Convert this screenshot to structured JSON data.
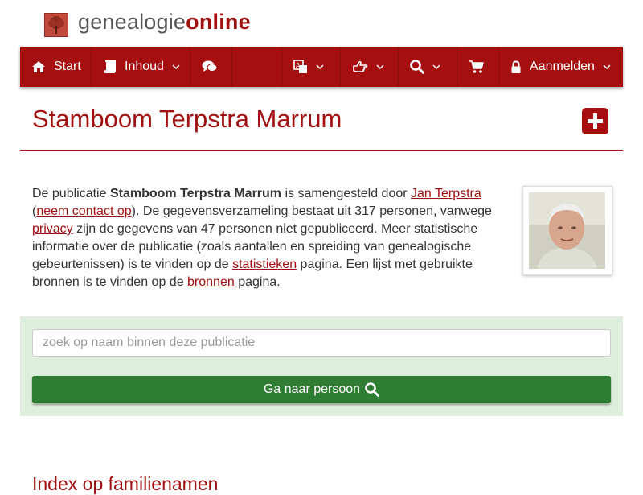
{
  "brand": {
    "part1": "genealogie",
    "part2": "online"
  },
  "nav": {
    "start": "Start",
    "inhoud": "Inhoud",
    "aanmelden": "Aanmelden"
  },
  "page": {
    "title": "Stamboom Terpstra Marrum"
  },
  "intro": {
    "t1": "De publicatie ",
    "pub_name": "Stamboom Terpstra Marrum",
    "t2": " is samengesteld door ",
    "author_link": "Jan Terpstra",
    "t3": " (",
    "contact_link": "neem contact op",
    "t4": "). De gegevensverzameling bestaat uit 317 personen, vanwege ",
    "privacy_link": "privacy",
    "t5": " zijn de gegevens van 47 personen niet gepubliceerd. Meer statistische informatie over de publicatie (zoals aantallen en spreiding van genealogische gebeurtenissen) is te vinden op de ",
    "stats_link": "statistieken",
    "t6": " pagina. Een lijst met gebruikte bronnen is te vinden op de ",
    "sources_link": "bronnen",
    "t7": " pagina."
  },
  "search": {
    "placeholder": "zoek op naam binnen deze publicatie",
    "button_label": "Ga naar persoon"
  },
  "section": {
    "heading": "Index op familienamen"
  },
  "colors": {
    "brand_red": "#a60f0f",
    "green_button": "#2e7d32",
    "search_bg": "#deeedd"
  },
  "icons": [
    "logo-tree-icon",
    "home-icon",
    "book-icon",
    "comments-icon",
    "language-icon",
    "hand-point-icon",
    "search-icon",
    "cart-icon",
    "lock-icon",
    "plus-icon",
    "chevron-down-icon"
  ]
}
